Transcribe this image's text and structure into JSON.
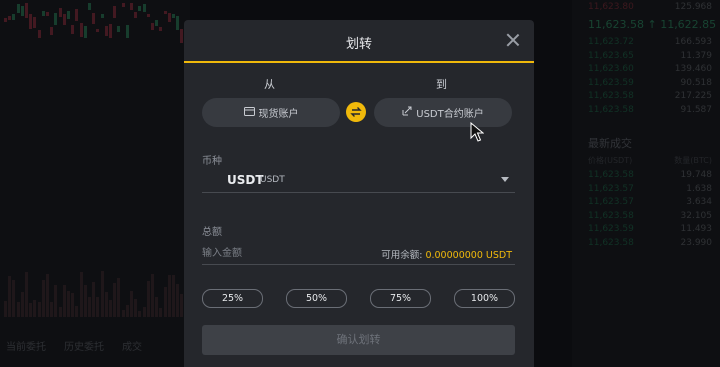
{
  "modal": {
    "title": "划转",
    "from_label": "从",
    "to_label": "到",
    "from_account": "现货账户",
    "to_account": "USDT合约账户",
    "coin_label": "币种",
    "coin_code": "USDT",
    "coin_name": "USDT",
    "amount_label": "总额",
    "amount_placeholder": "输入金额",
    "available_label": "可用余额:",
    "available_value": "0.00000000 USDT",
    "percent_options": [
      "25%",
      "50%",
      "75%",
      "100%"
    ],
    "confirm_label": "确认划转"
  },
  "background": {
    "last_price": "11,623.58 ↑ 11,622.85",
    "trades_title": "最新成交",
    "trades_header": [
      "价格(USDT)",
      "数量(BTC)"
    ],
    "bottom_tabs": [
      "当前委托",
      "历史委托",
      "成交"
    ],
    "ask_rows": [
      [
        "11,623.80",
        "125.968"
      ],
      [
        "11,623.72",
        "166.593"
      ],
      [
        "11,623.65",
        "11.379"
      ],
      [
        "11,623.60",
        "139.460"
      ],
      [
        "11,623.59",
        "90.518"
      ],
      [
        "11,623.58",
        "217.225"
      ],
      [
        "11,623.58",
        "91.587"
      ]
    ],
    "trade_rows": [
      [
        "11,623.58",
        "19.748"
      ],
      [
        "11,623.57",
        "1.638"
      ],
      [
        "11,623.57",
        "3.634"
      ],
      [
        "11,623.58",
        "32.105"
      ],
      [
        "11,623.59",
        "11.493"
      ],
      [
        "11,623.58",
        "23.990"
      ]
    ]
  },
  "colors": {
    "accent": "#f0b90b",
    "modal_bg": "#25272c",
    "up": "#2b7a5a",
    "down": "#7b2f3d"
  },
  "icons": {
    "from_account_icon": "wallet-icon",
    "to_account_icon": "contract-icon",
    "swap_icon": "swap-arrows-icon",
    "close_icon": "close-icon",
    "dropdown_icon": "caret-down-icon"
  }
}
